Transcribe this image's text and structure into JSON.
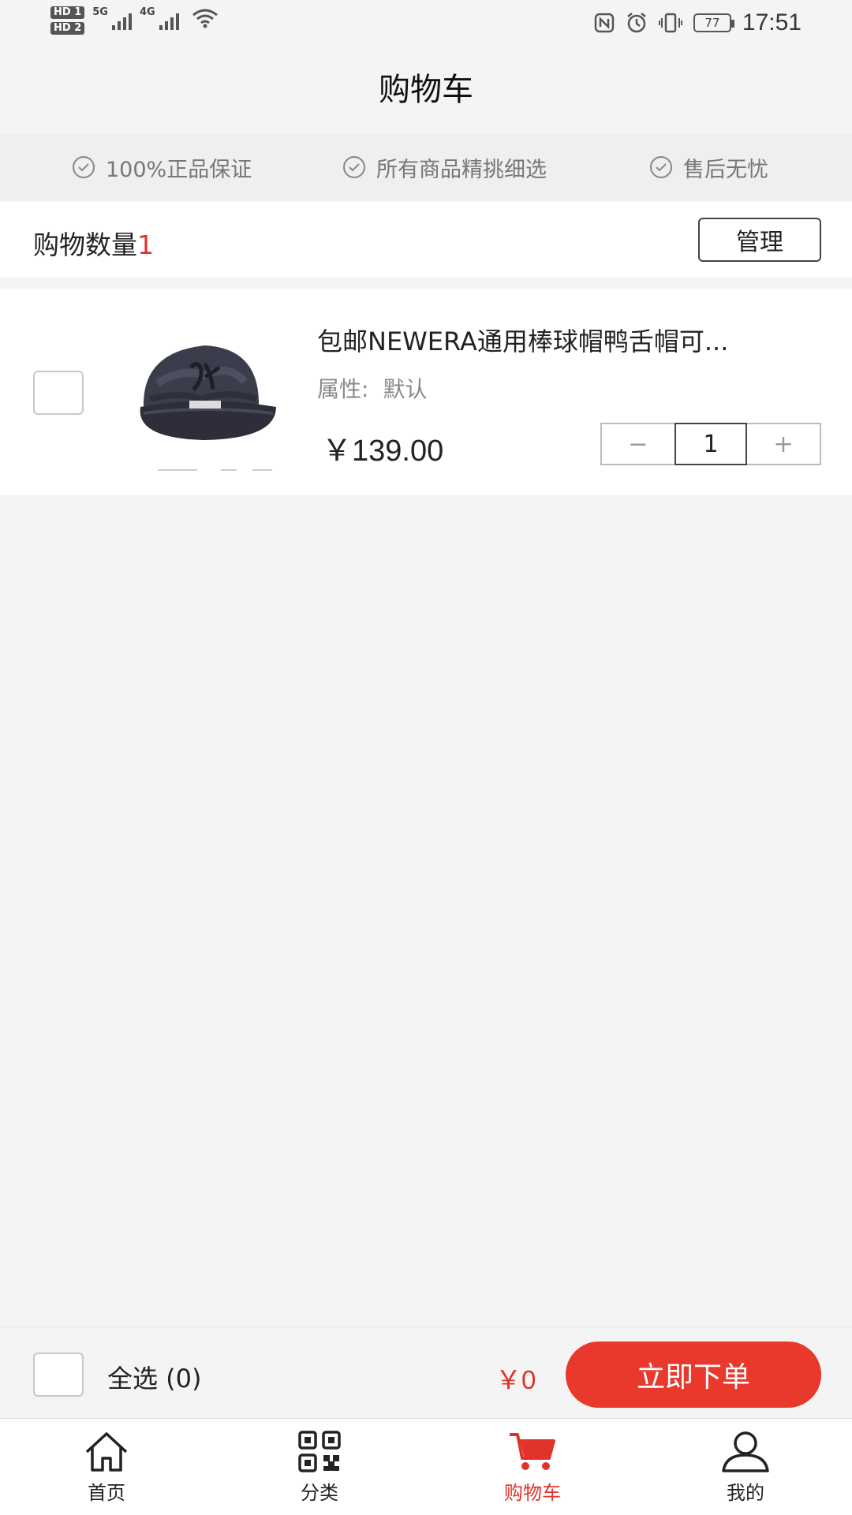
{
  "status_bar": {
    "hd1": "HD 1",
    "hd2": "HD 2",
    "net1": "5G",
    "net2": "4G",
    "battery": "77",
    "time": "17:51"
  },
  "header": {
    "title": "购物车"
  },
  "guarantees": [
    {
      "label": "100%正品保证"
    },
    {
      "label": "所有商品精挑细选"
    },
    {
      "label": "售后无忧"
    }
  ],
  "cart_summary": {
    "count_label": "购物数量",
    "count": "1",
    "manage_label": "管理"
  },
  "items": [
    {
      "title": "包邮NEWERA通用棒球帽鸭舌帽可...",
      "attr_label": "属性:",
      "attr_value": "默认",
      "price": "￥139.00",
      "qty_minus": "−",
      "qty": "1",
      "qty_plus": "+",
      "checked": false
    }
  ],
  "checkout": {
    "select_all_label": "全选 (0)",
    "total": "￥0",
    "order_label": "立即下单"
  },
  "tabs": [
    {
      "label": "首页",
      "icon": "home-icon",
      "active": false
    },
    {
      "label": "分类",
      "icon": "qrcode-icon",
      "active": false
    },
    {
      "label": "购物车",
      "icon": "cart-icon",
      "active": true
    },
    {
      "label": "我的",
      "icon": "user-icon",
      "active": false
    }
  ],
  "colors": {
    "accent": "#e0332a",
    "button": "#e8392c",
    "background": "#f4f4f4"
  }
}
